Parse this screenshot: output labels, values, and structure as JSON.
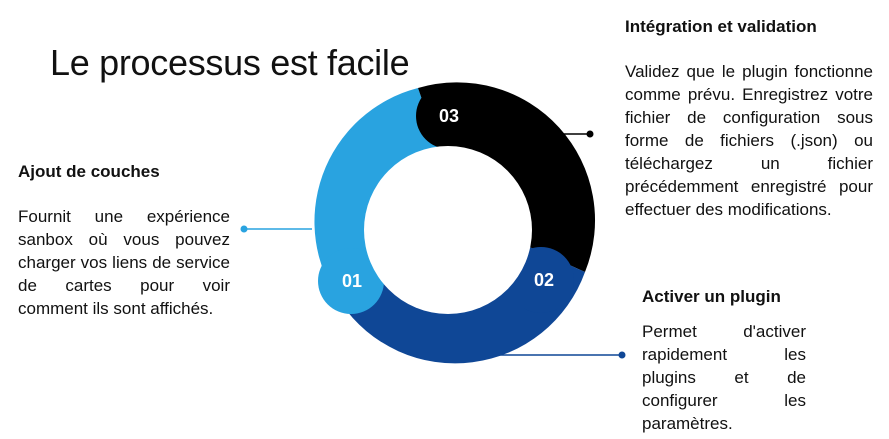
{
  "title": "Le processus est facile",
  "colors": {
    "step1": "#29a3e0",
    "step2": "#0f4796",
    "step3": "#000000",
    "connector": "#000000"
  },
  "steps": [
    {
      "number": "01",
      "heading": "Ajout de couches",
      "text": "Fournit une expérience sanbox où vous pouvez charger vos liens de service de cartes pour voir comment ils sont affichés."
    },
    {
      "number": "02",
      "heading": "Activer un plugin",
      "text": "Permet d'activer rapidement les plugins et de configurer les paramètres."
    },
    {
      "number": "03",
      "heading": "Intégration et validation",
      "text": "Validez que le plugin fonctionne comme prévu. Enregistrez votre fichier de configuration sous forme de fichiers (.json) ou téléchargez un fichier précédemment enregistré pour effectuer des modifications."
    }
  ]
}
